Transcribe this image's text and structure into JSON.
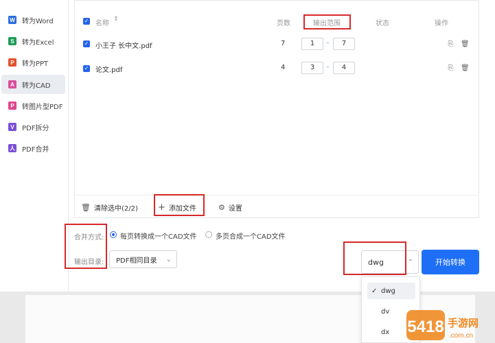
{
  "sidebar": {
    "items": [
      {
        "label": "转为Word",
        "icon_glyph": "W",
        "icon_color": "#2b6cde"
      },
      {
        "label": "转为Excel",
        "icon_glyph": "S",
        "icon_color": "#1f9d55"
      },
      {
        "label": "转为PPT",
        "icon_glyph": "P",
        "icon_color": "#e3522b"
      },
      {
        "label": "转为CAD",
        "icon_glyph": "A",
        "icon_color": "#d94f9b"
      },
      {
        "label": "转图片型PDF",
        "icon_glyph": "P",
        "icon_color": "#e0458b"
      },
      {
        "label": "PDF拆分",
        "icon_glyph": "V",
        "icon_color": "#7b4fd8"
      },
      {
        "label": "PDF合并",
        "icon_glyph": "人",
        "icon_color": "#7b4fd8"
      }
    ],
    "active_index": 3
  },
  "table": {
    "headers": {
      "name": "名称",
      "pages": "页数",
      "output_range": "输出范围",
      "status": "状态",
      "actions": "操作"
    },
    "rows": [
      {
        "name": "小王子 长中文.pdf",
        "pages": "7",
        "range_from": "1",
        "range_to": "7",
        "checked": true
      },
      {
        "name": "论文.pdf",
        "pages": "4",
        "range_from": "3",
        "range_to": "4",
        "checked": true
      }
    ],
    "range_separator": "–"
  },
  "bottom_bar": {
    "clear_label": "清除选中(2/2)",
    "add_label": "添加文件",
    "settings_label": "设置"
  },
  "options": {
    "merge_label": "合并方式:",
    "merge_option_1": "每页转换成一个CAD文件",
    "merge_option_2": "多页合成一个CAD文件",
    "output_dir_label": "输出目录:",
    "output_dir_value": "PDF相同目录"
  },
  "format_select": {
    "value": "dwg",
    "options": [
      "dwg",
      "dv",
      "dx"
    ]
  },
  "start_button_label": "开始转换",
  "watermark": {
    "text": "5418",
    "site_name": "手游网",
    "site_url": ".com.cn"
  },
  "colors": {
    "accent": "#1e6ff5",
    "highlight_box": "#d62828"
  }
}
